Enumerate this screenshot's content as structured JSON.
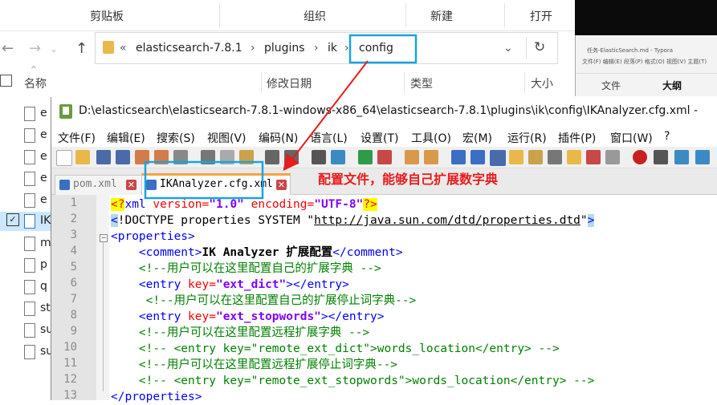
{
  "explorer": {
    "ribbon_groups": [
      "剪贴板",
      "组织",
      "新建",
      "打开"
    ],
    "nav_icons": [
      "back-arrow-icon",
      "forward-arrow-icon",
      "up-arrow-icon"
    ],
    "address": {
      "overflow": "«",
      "crumbs": [
        "elasticsearch-7.8.1",
        "plugins",
        "ik",
        "config"
      ],
      "separator": "›",
      "dropdown": "⌄",
      "refresh": "↻"
    },
    "columns": {
      "name": "名称",
      "date": "修改日期",
      "type": "类型",
      "size": "大小"
    },
    "sort_arrow": "^",
    "files": [
      "e",
      "e",
      "e",
      "e",
      "e",
      "e",
      "IK",
      "m",
      "p",
      "q",
      "st",
      "su",
      "su"
    ],
    "checked_mark": "✓"
  },
  "typora": {
    "title": "任务-ElasticSearch.md - Typora",
    "menu": "文件(F)  编辑(E)  段落(P)  格式(O)  视图(V)  主题(T)",
    "tabs": [
      "文件",
      "大纲"
    ]
  },
  "notepad": {
    "title": "D:\\elasticsearch\\elasticsearch-7.8.1-windows-x86_64\\elasticsearch-7.8.1\\plugins\\ik\\config\\IKAnalyzer.cfg.xml -",
    "menu": [
      "文件(F)",
      "编辑(E)",
      "搜索(S)",
      "视图(V)",
      "编码(N)",
      "语言(L)",
      "设置(T)",
      "工具(O)",
      "宏(M)",
      "运行(R)",
      "插件(P)",
      "窗口(W)",
      "?"
    ],
    "tabs": [
      {
        "label": "pom.xml",
        "close": "✕"
      },
      {
        "label": "IKAnalyzer.cfg.xml",
        "close": "✕"
      }
    ],
    "annotation": "配置文件，能够自己扩展数字典",
    "line_numbers": [
      "1",
      "2",
      "3",
      "4",
      "5",
      "6",
      "7",
      "8",
      "9",
      "10",
      "11",
      "12",
      "13"
    ],
    "code": {
      "l1": {
        "pi_open": "<?",
        "xml": "xml",
        "version_attr": " version=",
        "version_val": "\"1.0\"",
        "encoding_attr": " encoding=",
        "encoding_val": "\"UTF-8\"",
        "pi_close": "?>"
      },
      "l2": {
        "open": "<",
        "doctype": "!DOCTYPE properties SYSTEM \"",
        "url": "http://java.sun.com/dtd/properties.dtd",
        "close_quote": "\"",
        "close": ">"
      },
      "l3": {
        "tag": "<properties>"
      },
      "l4": {
        "indent": "    ",
        "open": "<comment>",
        "text": "IK Analyzer 扩展配置",
        "close": "</comment>"
      },
      "l5": {
        "indent": "    ",
        "comment": "<!--用户可以在这里配置自己的扩展字典 -->"
      },
      "l6": {
        "indent": "    ",
        "open": "<entry",
        "attr": " key=",
        "val": "\"ext_dict\"",
        "close": "></entry>"
      },
      "l7": {
        "indent": "     ",
        "comment": "<!--用户可以在这里配置自己的扩展停止词字典-->"
      },
      "l8": {
        "indent": "    ",
        "open": "<entry",
        "attr": " key=",
        "val": "\"ext_stopwords\"",
        "close": "></entry>"
      },
      "l9": {
        "indent": "    ",
        "comment": "<!--用户可以在这里配置远程扩展字典 -->"
      },
      "l10": {
        "indent": "    ",
        "comment": "<!-- <entry key=\"remote_ext_dict\">words_location</entry> -->"
      },
      "l11": {
        "indent": "    ",
        "comment": "<!--用户可以在这里配置远程扩展停止词字典-->"
      },
      "l12": {
        "indent": "    ",
        "comment": "<!-- <entry key=\"remote_ext_stopwords\">words_location</entry> -->"
      },
      "l13": {
        "tag": "</properties>"
      }
    },
    "fold_marks": {
      "minus": "−"
    }
  },
  "colors": {
    "highlight_box": "#1aa3e0",
    "annotation": "#e81c1c",
    "tag": "#0000ff",
    "attr": "#ff0000",
    "value": "#8000ff",
    "comment": "#008000"
  }
}
